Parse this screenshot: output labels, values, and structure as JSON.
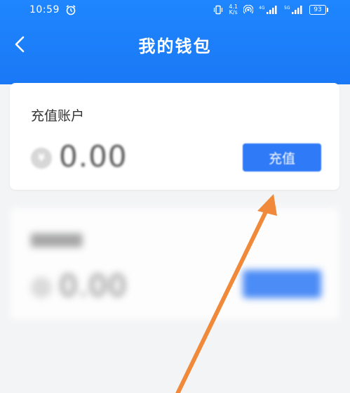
{
  "status_bar": {
    "time": "10:59",
    "net_speed_value": "4.1",
    "net_speed_unit": "K/s",
    "net_4g": "4G",
    "net_5g": "5G",
    "battery": "93"
  },
  "header": {
    "title": "我的钱包"
  },
  "recharge_account": {
    "label": "充值账户",
    "currency_symbol": "¥",
    "balance": "0.00",
    "button_label": "充值"
  },
  "second_account": {
    "balance": "0.00"
  },
  "colors": {
    "header": "#1f86ff",
    "button": "#2f7af7",
    "arrow": "#f08a3a",
    "background": "#f3f4f6"
  }
}
